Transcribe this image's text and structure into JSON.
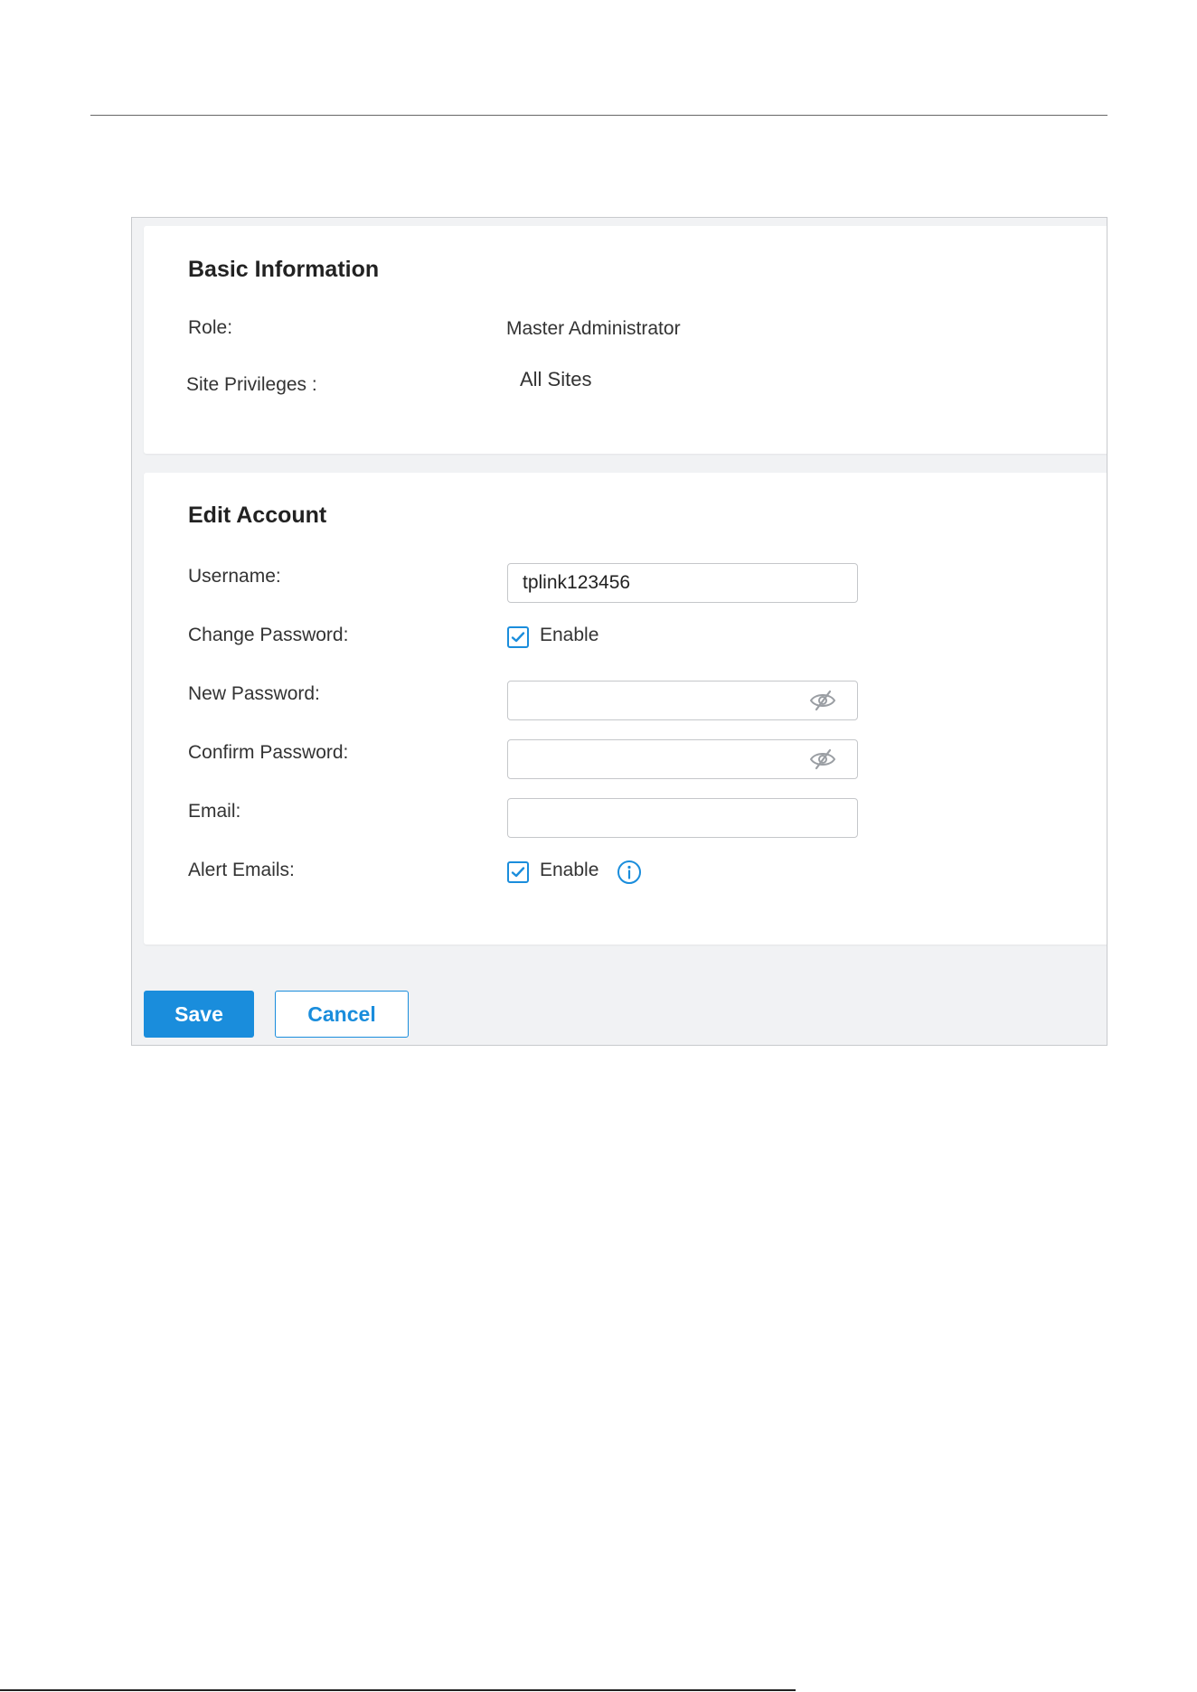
{
  "basic_info": {
    "title": "Basic Information",
    "role_label": "Role:",
    "role_value": "Master Administrator",
    "site_privileges_label": "Site Privileges :",
    "site_privileges_value": "All Sites"
  },
  "edit_account": {
    "title": "Edit Account",
    "username_label": "Username:",
    "username_value": "tplink123456",
    "change_password_label": "Change Password:",
    "change_password_checked": true,
    "change_password_option": "Enable",
    "new_password_label": "New Password:",
    "new_password_value": "",
    "confirm_password_label": "Confirm Password:",
    "confirm_password_value": "",
    "email_label": "Email:",
    "email_value": "",
    "alert_emails_label": "Alert Emails:",
    "alert_emails_checked": true,
    "alert_emails_option": "Enable",
    "hidden_password_icon": "eye-slash-icon",
    "info_icon": "info-icon"
  },
  "actions": {
    "save_label": "Save",
    "cancel_label": "Cancel"
  },
  "colors": {
    "accent": "#1a8ddc",
    "background": "#f1f2f4",
    "card": "#ffffff"
  }
}
